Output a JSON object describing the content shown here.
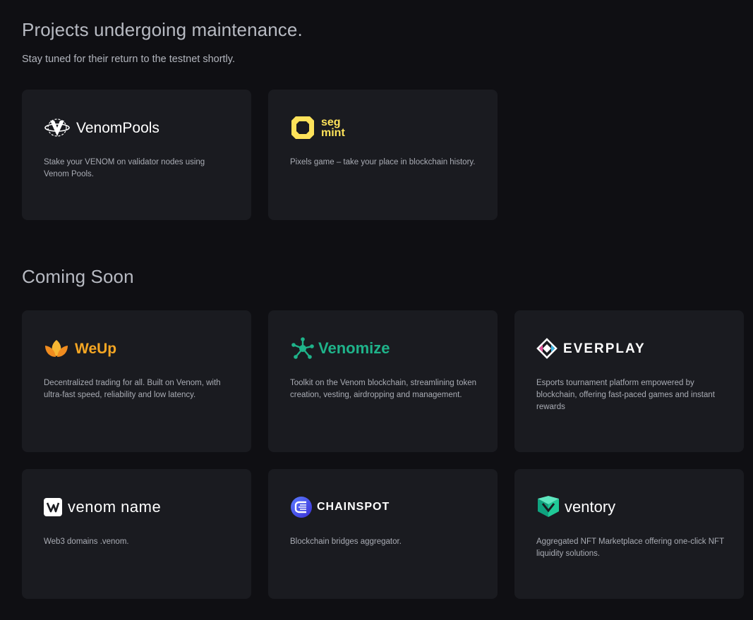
{
  "maintenance": {
    "title": "Projects undergoing maintenance.",
    "subtitle": "Stay tuned for their return to the testnet shortly.",
    "cards": [
      {
        "name": "VenomPools",
        "description": "Stake your VENOM on validator nodes using Venom Pools.",
        "icon": "venompools-logo-icon",
        "color": "#ffffff"
      },
      {
        "name_line1": "seg",
        "name_line2": "mint",
        "description": "Pixels game – take your place in blockchain history.",
        "icon": "segmint-logo-icon",
        "color": "#fde25a"
      }
    ]
  },
  "coming_soon": {
    "title": "Coming Soon",
    "cards": [
      {
        "name": "WeUp",
        "description": "Decentralized trading for all. Built on Venom, with ultra-fast speed, reliability and low latency.",
        "icon": "weup-lotus-icon",
        "color": "#f5a623"
      },
      {
        "name": "Venomize",
        "description": "Toolkit on the Venom blockchain, streamlining token creation, vesting, airdropping and management.",
        "icon": "venomize-network-icon",
        "color": "#1fb38a"
      },
      {
        "name": "EVERPLAY",
        "description": "Esports tournament platform empowered by blockchain, offering fast-paced games and instant rewards",
        "icon": "everplay-diamond-icon",
        "color": "#ffffff"
      },
      {
        "name": "venom name",
        "description": "Web3 domains .venom.",
        "icon": "venom-name-logo-icon",
        "color": "#ffffff"
      },
      {
        "name": "CHAINSPOT",
        "description": "Blockchain bridges aggregator.",
        "icon": "chainspot-logo-icon",
        "color": "#ffffff"
      },
      {
        "name": "ventory",
        "description": "Aggregated NFT Marketplace offering one-click NFT liquidity solutions.",
        "icon": "ventory-cube-icon",
        "color": "#20c997"
      }
    ]
  }
}
